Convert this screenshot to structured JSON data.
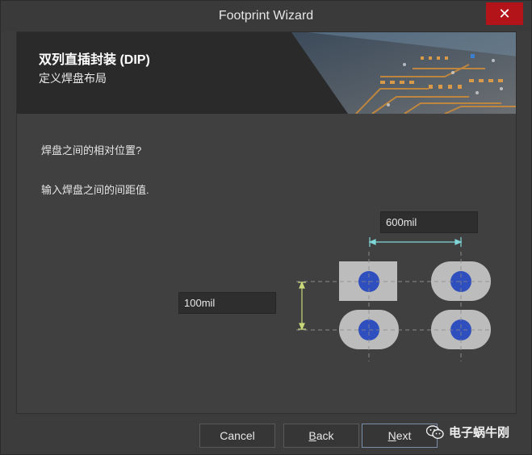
{
  "window": {
    "title": "Footprint Wizard"
  },
  "banner": {
    "title": "双列直插封装 (DIP)",
    "subtitle": "定义焊盘布局"
  },
  "body": {
    "question": "焊盘之间的相对位置?",
    "instruction": "输入焊盘之间的间距值."
  },
  "fields": {
    "horizontal_spacing": "600mil",
    "vertical_spacing": "100mil"
  },
  "buttons": {
    "cancel": "Cancel",
    "back_prefix": "",
    "back_access": "B",
    "back_rest": "ack",
    "next_access": "N",
    "next_rest": "ext"
  },
  "watermark": {
    "text": "电子蜗牛刚"
  },
  "colors": {
    "close": "#b3141a",
    "pad_fill": "#bcbcbc",
    "pad_hole": "#2f4fbf",
    "h_arrow": "#7fd6d6",
    "v_arrow": "#c9d97a"
  }
}
